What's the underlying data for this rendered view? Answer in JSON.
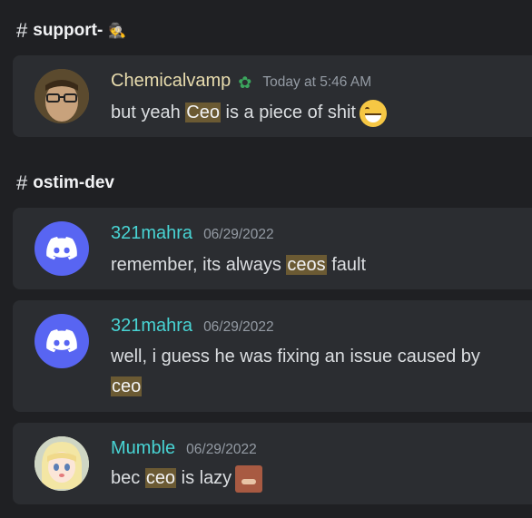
{
  "sections": [
    {
      "channel": "support-",
      "channel_emoji": "🕵",
      "messages": [
        {
          "author": "Chemicalvamp",
          "author_color": "#e8dcae",
          "timestamp": "Today at 5:46 AM",
          "avatar_type": "photo",
          "badge_icon": "green-sprout-icon",
          "text_parts": [
            "but yeah ",
            "Ceo",
            " is a piece of shit"
          ],
          "trailing_emoji": "grinning-face"
        }
      ]
    },
    {
      "channel": "ostim-dev",
      "messages": [
        {
          "author": "321mahra",
          "author_color": "#48d4d4",
          "timestamp": "06/29/2022",
          "avatar_type": "discord",
          "text_parts": [
            "remember, its always ",
            "ceos",
            " fault"
          ]
        },
        {
          "author": "321mahra",
          "author_color": "#48d4d4",
          "timestamp": "06/29/2022",
          "avatar_type": "discord",
          "text_parts": [
            "well, i guess he was fixing an issue caused by ",
            "ceo",
            ""
          ]
        },
        {
          "author": "Mumble",
          "author_color": "#48d4d4",
          "timestamp": "06/29/2022",
          "avatar_type": "anime",
          "text_parts": [
            "bec ",
            "ceo",
            " is lazy"
          ],
          "trailing_emoji": "custom-laughing-sticker"
        }
      ]
    }
  ]
}
